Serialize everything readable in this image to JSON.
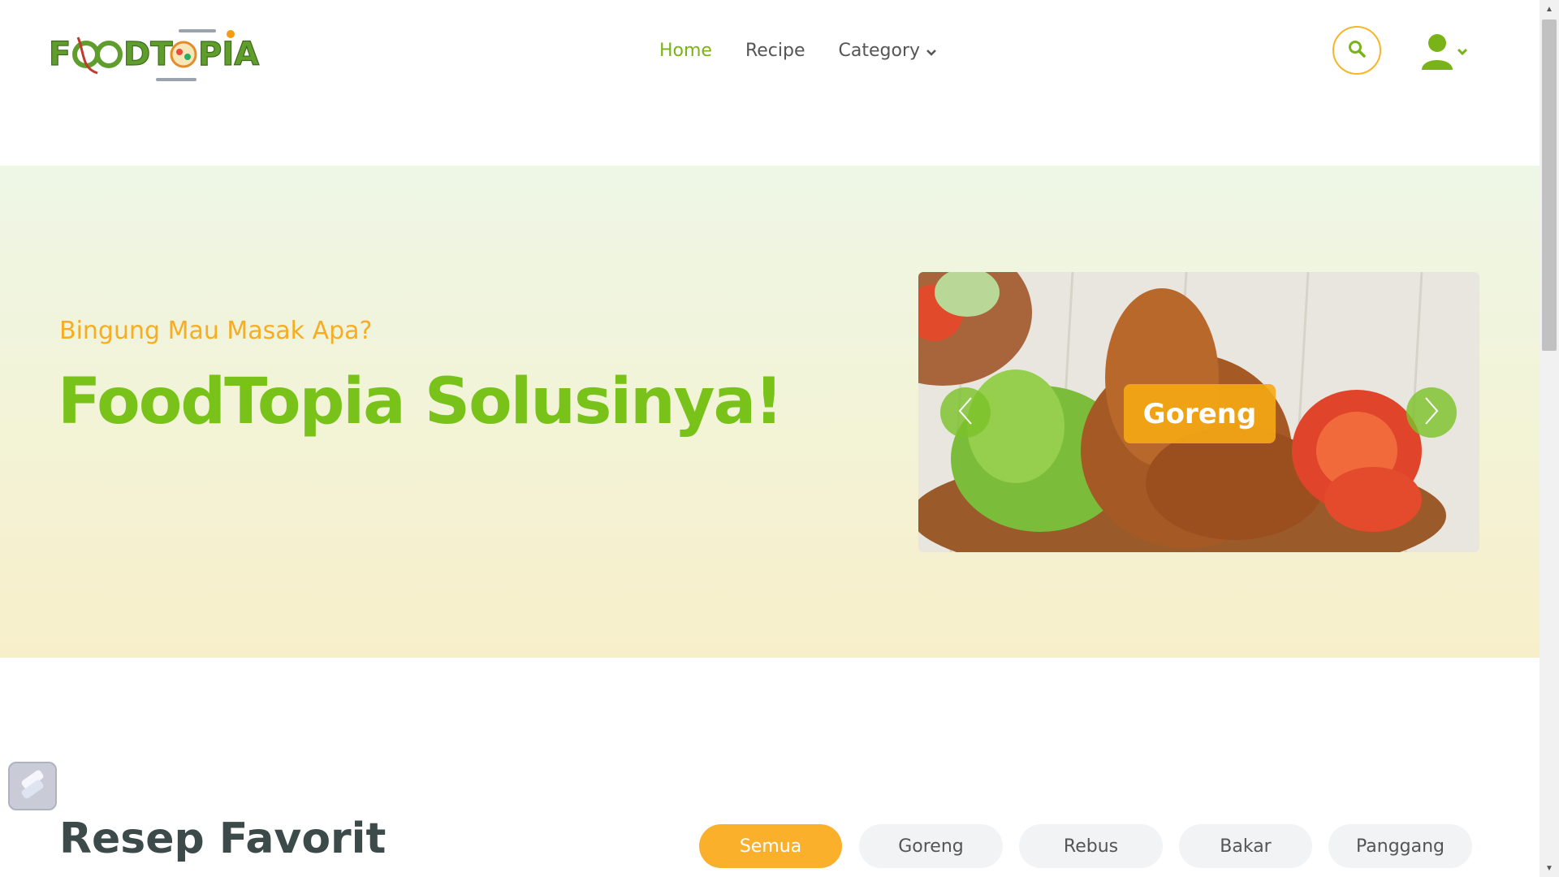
{
  "logo": {
    "text": "FOODTOPIA"
  },
  "nav": {
    "items": [
      {
        "label": "Home",
        "active": true
      },
      {
        "label": "Recipe",
        "active": false
      },
      {
        "label": "Category",
        "active": false,
        "has_dropdown": true
      }
    ]
  },
  "header_icons": {
    "search": "search-icon",
    "user": "user-icon"
  },
  "hero": {
    "subtitle": "Bingung Mau Masak Apa?",
    "title": "FoodTopia Solusinya!",
    "carousel": {
      "caption": "Goreng",
      "prev_icon": "chevron-left-icon",
      "next_icon": "chevron-right-icon"
    }
  },
  "favorites": {
    "title": "Resep Favorit",
    "filters": [
      {
        "label": "Semua",
        "active": true
      },
      {
        "label": "Goreng",
        "active": false
      },
      {
        "label": "Rebus",
        "active": false
      },
      {
        "label": "Bakar",
        "active": false
      },
      {
        "label": "Panggang",
        "active": false
      }
    ]
  },
  "colors": {
    "brand_green": "#78c21a",
    "accent_orange": "#f6ad22",
    "filter_active": "#fbb02b",
    "heading_dark": "#3c4a4a"
  }
}
